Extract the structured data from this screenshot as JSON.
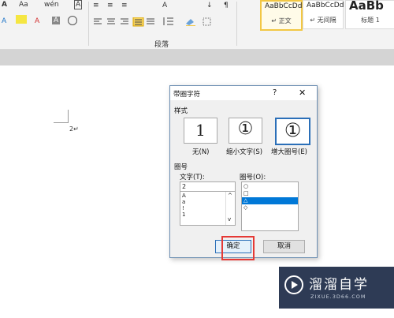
{
  "ribbon": {
    "font_row": [
      "A",
      "Aa",
      "wén",
      "A"
    ],
    "font_row2": [
      "A",
      "A",
      "A",
      "A"
    ],
    "para_row1": [
      "≡",
      "≡",
      "≡",
      "A",
      "↓",
      "¶"
    ],
    "group_label": "段落",
    "styles": [
      {
        "preview": "AaBbCcDd",
        "name": "↵ 正文"
      },
      {
        "preview": "AaBbCcDd",
        "name": "↵ 无间隔"
      },
      {
        "preview": "AaBb",
        "name": "标题 1"
      }
    ]
  },
  "document": {
    "text": "2↵"
  },
  "dialog": {
    "title": "带圈字符",
    "help": "?",
    "close": "✕",
    "style_section": "样式",
    "style_options": [
      {
        "glyph": "1",
        "label": "无(N)"
      },
      {
        "glyph": "①",
        "label": "缩小文字(S)"
      },
      {
        "glyph": "①",
        "label": "增大圈号(E)"
      }
    ],
    "enclosure_section": "圈号",
    "text_label": "文字(T):",
    "text_value": "2",
    "text_list": [
      "A",
      "a",
      "!",
      "1"
    ],
    "enclosure_label": "圈号(O):",
    "enclosure_list": [
      "○",
      "□",
      "△",
      "◇"
    ],
    "selected_enclosure": "△",
    "ok": "确定",
    "cancel": "取消"
  },
  "watermark": {
    "brand": "溜溜自学",
    "url": "ZIXUE.3D66.COM"
  },
  "colors": {
    "selection": "#0078d7",
    "highlight_box": "#e53935",
    "dialog_border": "#6d8fb3",
    "watermark_bg": "#2e3b55"
  }
}
